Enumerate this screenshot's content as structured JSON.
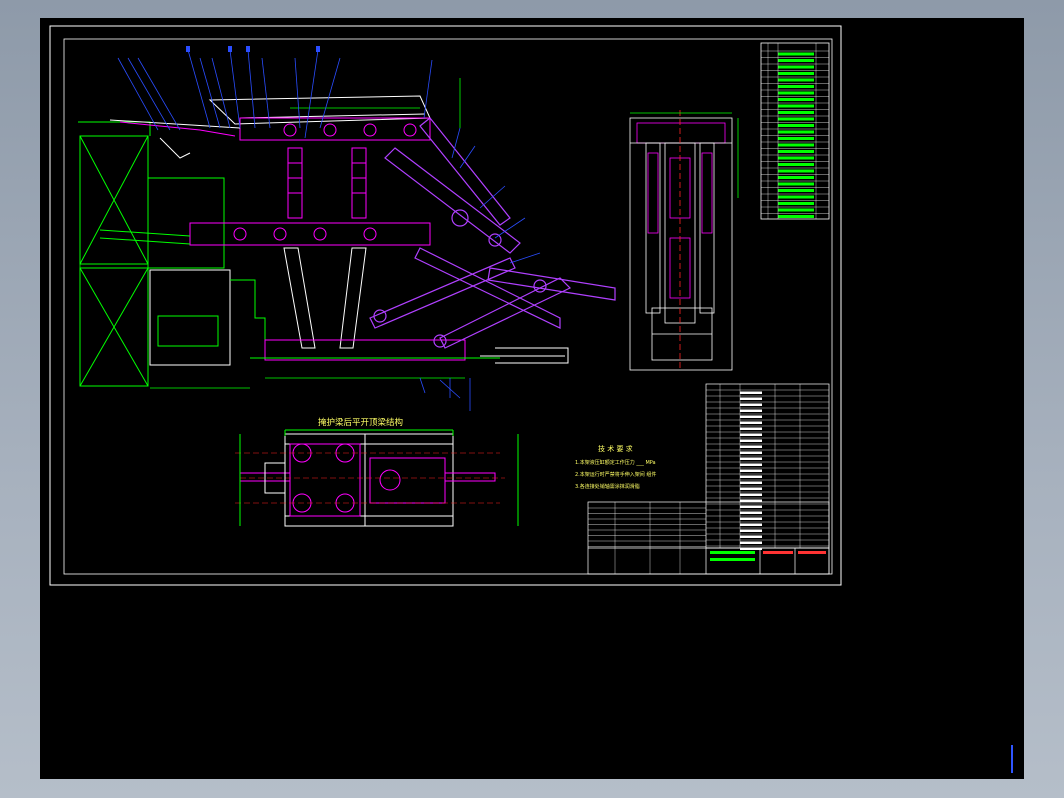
{
  "drawing": {
    "section_title": "掩护梁后平开顶梁结构",
    "notes_heading": "技 术 要 求",
    "notes": [
      "1.本架液压缸额定工作压力 ___ MPa",
      "2.本架运行时严禁将手伸入架间 组件",
      "3.各连接处销轴需涂抹润滑脂"
    ],
    "colors": {
      "background": "#000000",
      "border": "#ffffff",
      "structure": "#ff00ff",
      "linkage": "#8a2be2",
      "dimension": "#00ff00",
      "leader": "#1f3dff",
      "frame": "#ffffff",
      "center_line": "#ff2222",
      "green_fill": "#00ff00"
    }
  }
}
